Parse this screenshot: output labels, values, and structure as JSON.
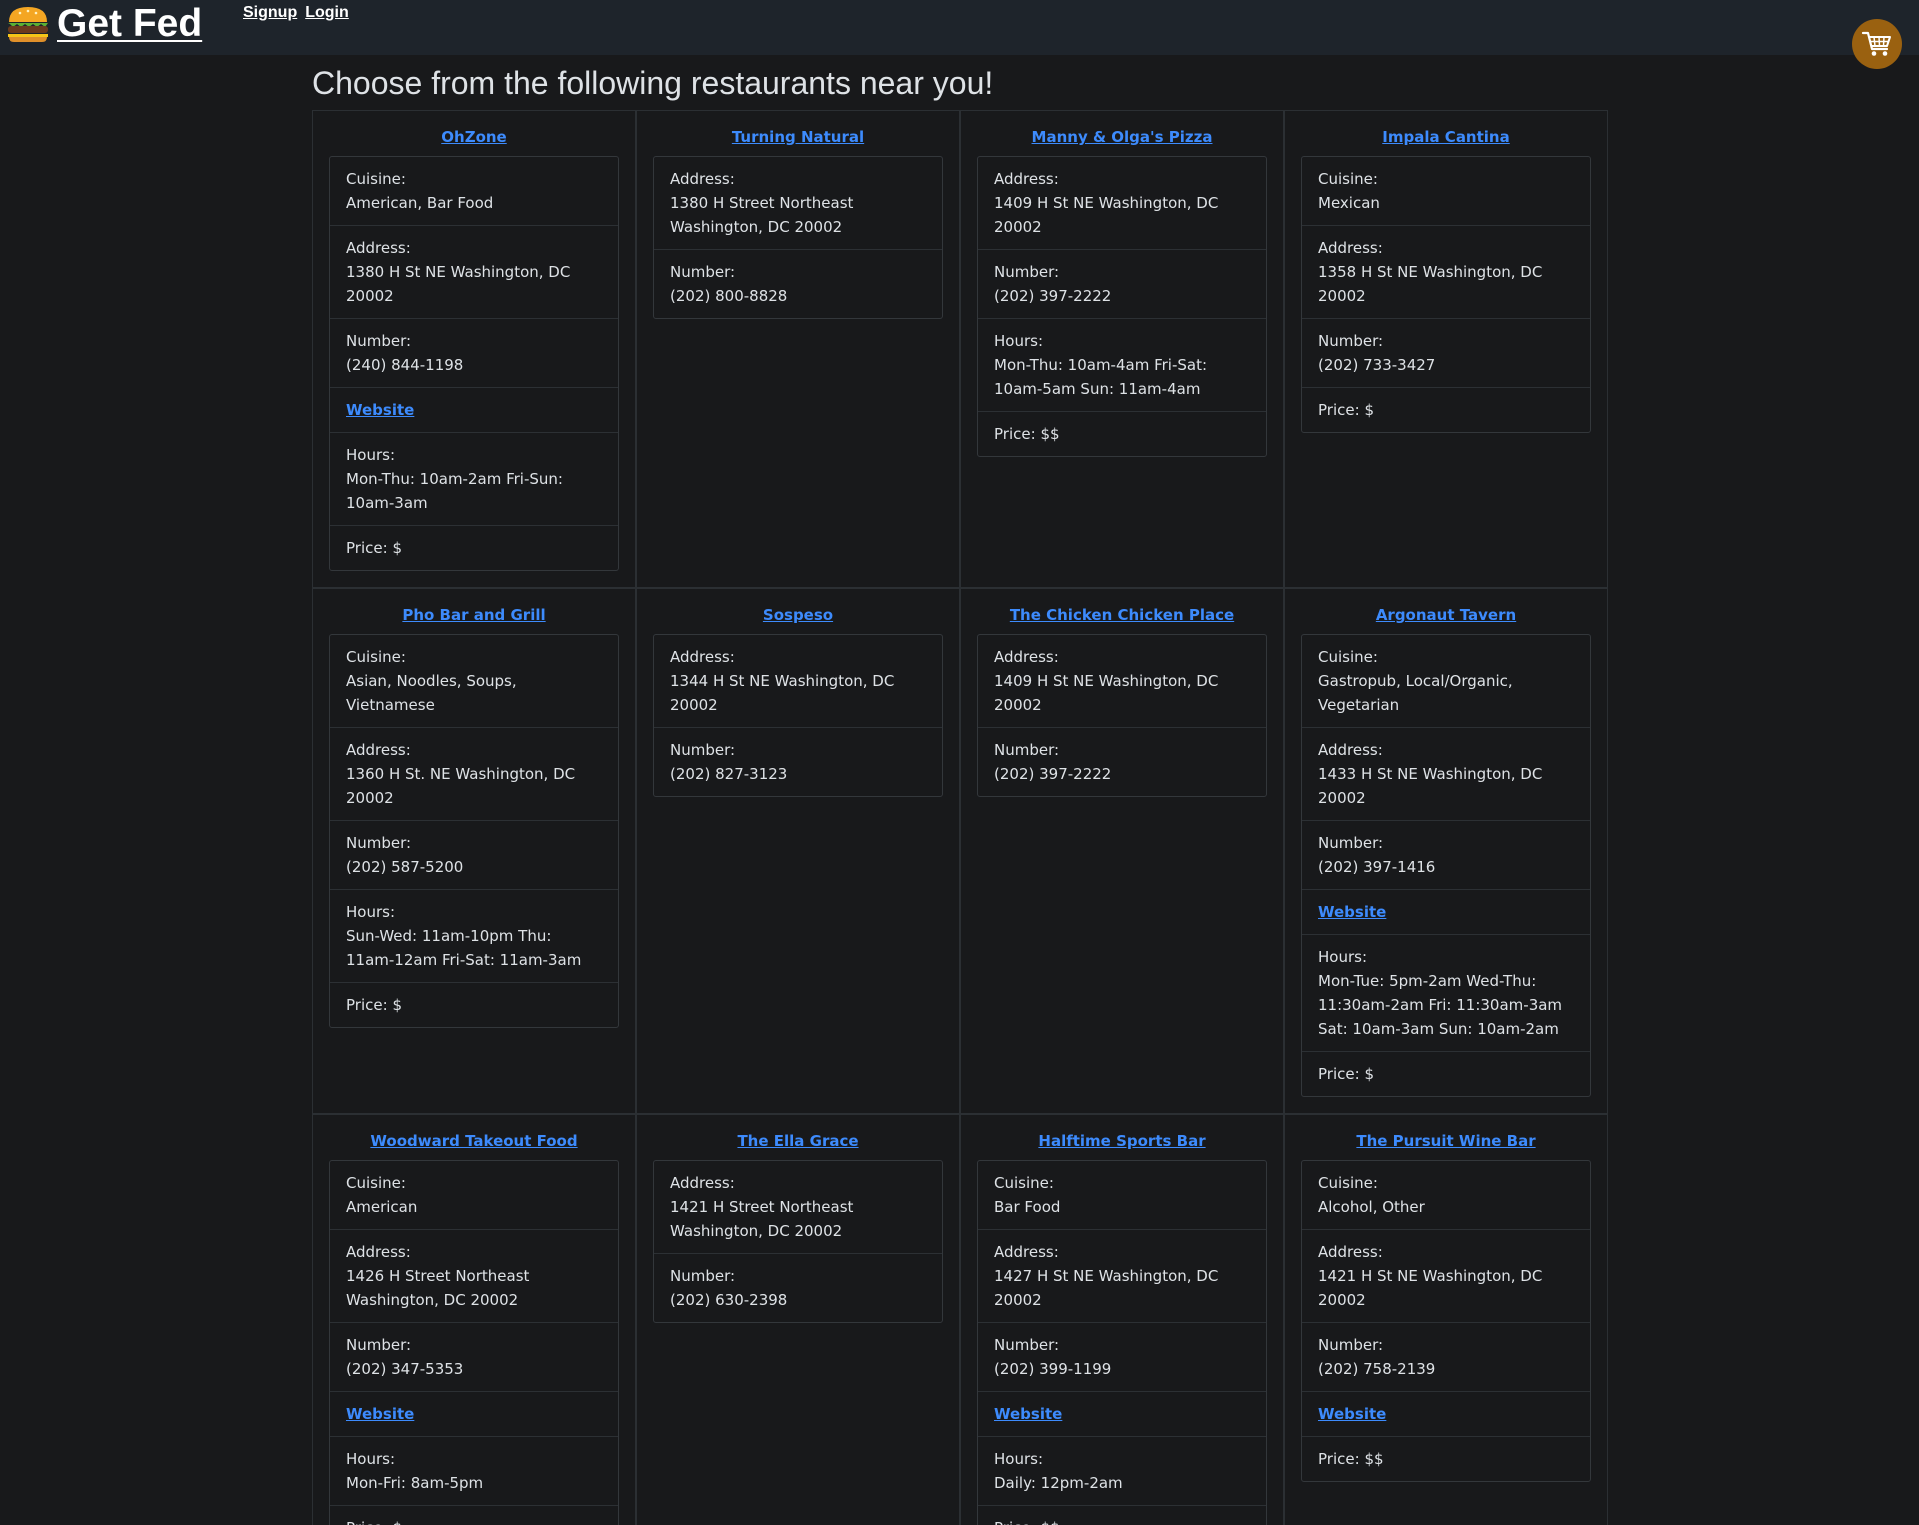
{
  "nav": {
    "brand": "Get Fed",
    "links": [
      "Signup",
      "Login"
    ],
    "cart_icon": "shopping-cart-icon",
    "cart_color": "#9a6110"
  },
  "heading": "Choose from the following restaurants near you!",
  "labels": {
    "cuisine": "Cuisine:",
    "address": "Address:",
    "number": "Number:",
    "website": "Website",
    "hours": "Hours:",
    "price": "Price:"
  },
  "colors": {
    "background": "#18191b",
    "navbar": "#1e242b",
    "link": "#3d8bfd",
    "text": "#dee2e6"
  },
  "rows": [
    [
      {
        "name": "OhZone",
        "cuisine": "American, Bar Food",
        "address": "1380 H St NE Washington, DC 20002",
        "number": "(240) 844-1198",
        "website": true,
        "hours": "Mon-Thu: 10am-2am Fri-Sun: 10am-3am",
        "price": "$"
      },
      {
        "name": "Turning Natural",
        "address": "1380 H Street Northeast Washington, DC 20002",
        "number": "(202) 800-8828"
      },
      {
        "name": "Manny & Olga's Pizza",
        "address": "1409 H St NE Washington, DC 20002",
        "number": "(202) 397-2222",
        "hours": "Mon-Thu: 10am-4am Fri-Sat: 10am-5am Sun: 11am-4am",
        "price": "$$"
      },
      {
        "name": "Impala Cantina",
        "cuisine": "Mexican",
        "address": "1358 H St NE Washington, DC 20002",
        "number": "(202) 733-3427",
        "price": "$"
      }
    ],
    [
      {
        "name": "Pho Bar and Grill",
        "cuisine": "Asian, Noodles, Soups, Vietnamese",
        "address": "1360 H St. NE Washington, DC 20002",
        "number": "(202) 587-5200",
        "hours": "Sun-Wed: 11am-10pm Thu: 11am-12am Fri-Sat: 11am-3am",
        "price": "$"
      },
      {
        "name": "Sospeso",
        "address": "1344 H St NE Washington, DC 20002",
        "number": "(202) 827-3123"
      },
      {
        "name": "The Chicken Chicken Place",
        "address": "1409 H St NE Washington, DC 20002",
        "number": "(202) 397-2222"
      },
      {
        "name": "Argonaut Tavern",
        "cuisine": "Gastropub, Local/Organic, Vegetarian",
        "address": "1433 H St NE Washington, DC 20002",
        "number": "(202) 397-1416",
        "website": true,
        "hours": "Mon-Tue: 5pm-2am Wed-Thu: 11:30am-2am Fri: 11:30am-3am Sat: 10am-3am Sun: 10am-2am",
        "price": "$"
      }
    ],
    [
      {
        "name": "Woodward Takeout Food",
        "cuisine": "American",
        "address": "1426 H Street Northeast Washington, DC 20002",
        "number": "(202) 347-5353",
        "website": true,
        "hours": "Mon-Fri: 8am-5pm",
        "price": "$"
      },
      {
        "name": "The Ella Grace",
        "address": "1421 H Street Northeast Washington, DC 20002",
        "number": "(202) 630-2398"
      },
      {
        "name": "Halftime Sports Bar",
        "cuisine": "Bar Food",
        "address": "1427 H St NE Washington, DC 20002",
        "number": "(202) 399-1199",
        "website": true,
        "hours": "Daily: 12pm-2am",
        "price": "$$"
      },
      {
        "name": "The Pursuit Wine Bar",
        "cuisine": "Alcohol, Other",
        "address": "1421 H St NE Washington, DC 20002",
        "number": "(202) 758-2139",
        "website": true,
        "price": "$$"
      }
    ]
  ]
}
